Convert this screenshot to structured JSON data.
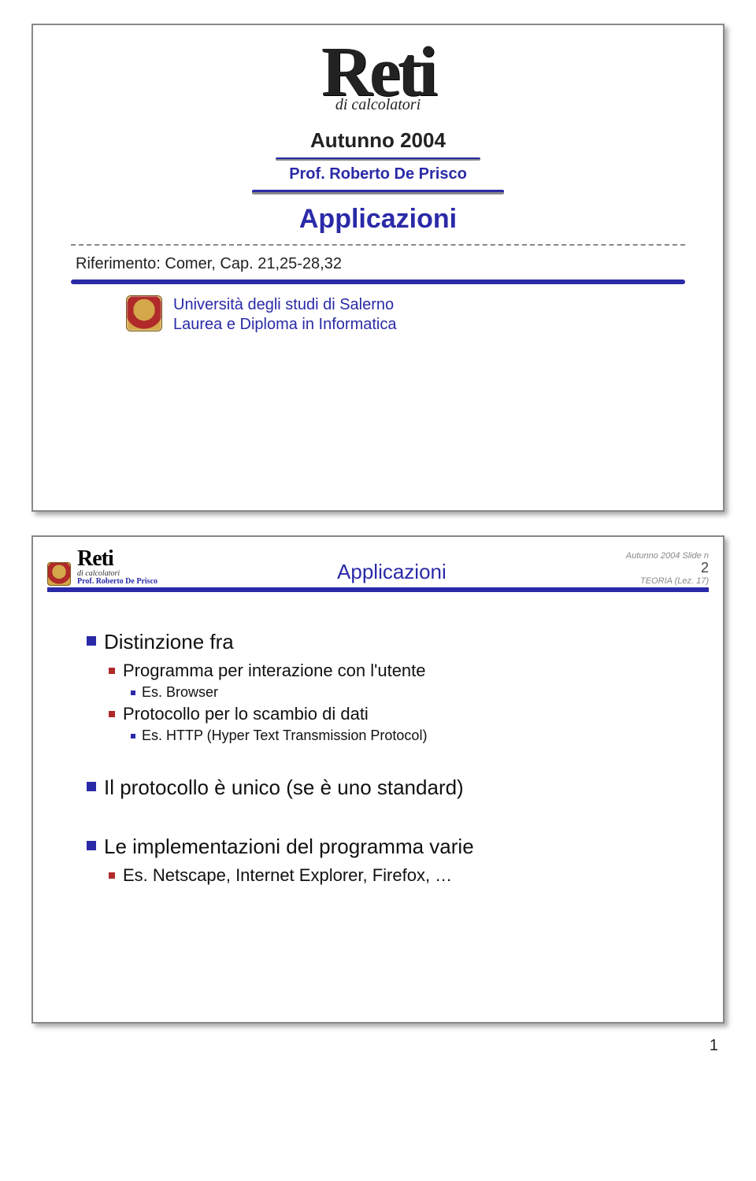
{
  "slide1": {
    "logo": "Reti",
    "logo_sub": "di calcolatori",
    "autunno": "Autunno 2004",
    "prof_line": "Prof. Roberto De Prisco",
    "title": "Applicazioni",
    "riferimento": "Riferimento: Comer, Cap. 21,25-28,32",
    "uni1": "Università degli studi di Salerno",
    "uni2": "Laurea e Diploma in Informatica"
  },
  "slide2": {
    "mini_reti": "Reti",
    "mini_sub": "di calcolatori",
    "mini_prof": "Prof. Roberto De Prisco",
    "title": "Applicazioni",
    "meta_line": "Autunno 2004 Slide n",
    "meta_num": "2",
    "meta_teoria": "TEORIA (Lez. 17)",
    "b1_1": "Distinzione fra",
    "b2_1": "Programma per interazione con l'utente",
    "b3_1": "Es. Browser",
    "b2_2": "Protocollo per lo scambio di dati",
    "b3_2": "Es. HTTP (Hyper Text Transmission Protocol)",
    "b1_2": "Il protocollo è unico (se è uno standard)",
    "b1_3": "Le implementazioni del programma varie",
    "b2_3": "Es. Netscape, Internet Explorer, Firefox, …"
  },
  "page_number": "1"
}
